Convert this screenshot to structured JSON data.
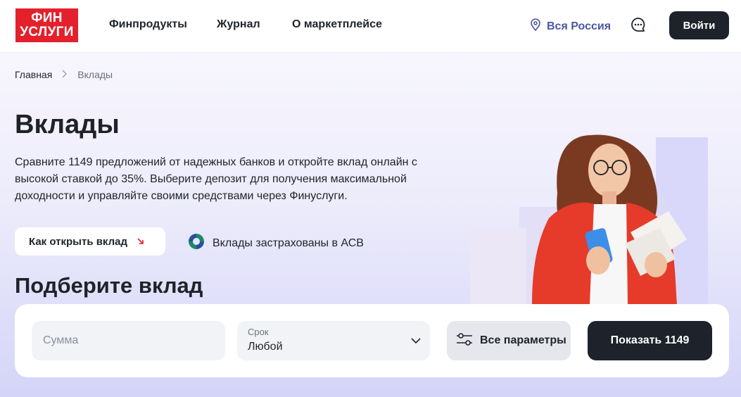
{
  "header": {
    "logo_line1": "ФИН",
    "logo_line2": "УСЛУГИ",
    "nav": [
      "Финпродукты",
      "Журнал",
      "О маркетплейсе"
    ],
    "region": "Вся Россия",
    "login_label": "Войти"
  },
  "breadcrumb": {
    "home": "Главная",
    "current": "Вклады"
  },
  "hero": {
    "title": "Вклады",
    "description": "Сравните 1149 предложений от надежных банков и откройте вклад онлайн с высокой ставкой до 35%. Выберите депозит для получения максимальной доходности и управляйте своими средствами через Финуслуги.",
    "how_to_label": "Как открыть вклад",
    "insured_label": "Вклады застрахованы в АСВ",
    "subtitle": "Подберите вклад"
  },
  "filter": {
    "amount_placeholder": "Сумма",
    "term_label": "Срок",
    "term_value": "Любой",
    "params_label": "Все параметры",
    "show_label": "Показать 1149"
  },
  "colors": {
    "brand_red": "#e3202b",
    "dark": "#1d222b",
    "region_blue": "#4b56a1"
  },
  "icons": [
    "location-pin-icon",
    "chat-icon",
    "chevron-right-icon",
    "arrow-down-right-icon",
    "asv-logo-icon",
    "chevron-down-icon",
    "sliders-icon"
  ]
}
